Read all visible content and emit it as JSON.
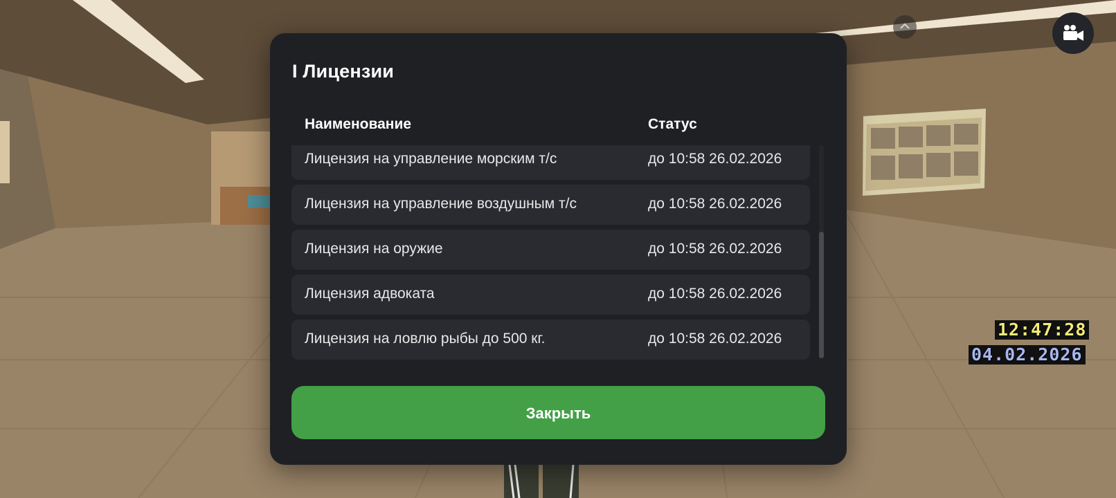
{
  "modal": {
    "title": "I Лицензии",
    "columns": {
      "name": "Наименование",
      "status": "Статус"
    },
    "rows": [
      {
        "name": "Лицензия на управление морским т/с",
        "status": "до 10:58 26.02.2026"
      },
      {
        "name": "Лицензия на управление воздушным т/с",
        "status": "до 10:58 26.02.2026"
      },
      {
        "name": "Лицензия на оружие",
        "status": "до 10:58 26.02.2026"
      },
      {
        "name": "Лицензия адвоката",
        "status": "до 10:58 26.02.2026"
      },
      {
        "name": "Лицензия на ловлю рыбы до 500 кг.",
        "status": "до 10:58 26.02.2026"
      }
    ],
    "close_label": "Закрыть"
  },
  "hud": {
    "time": "12:47:28",
    "date": "04.02.2026"
  },
  "icons": {
    "camera": "video-camera-icon",
    "chevron": "chevron-up-icon"
  },
  "colors": {
    "modal_bg": "#1f2024",
    "row_bg": "#2a2b30",
    "close_button": "#43a047",
    "hud_time": "#f4ec79",
    "hud_date": "#a7b7f0"
  }
}
